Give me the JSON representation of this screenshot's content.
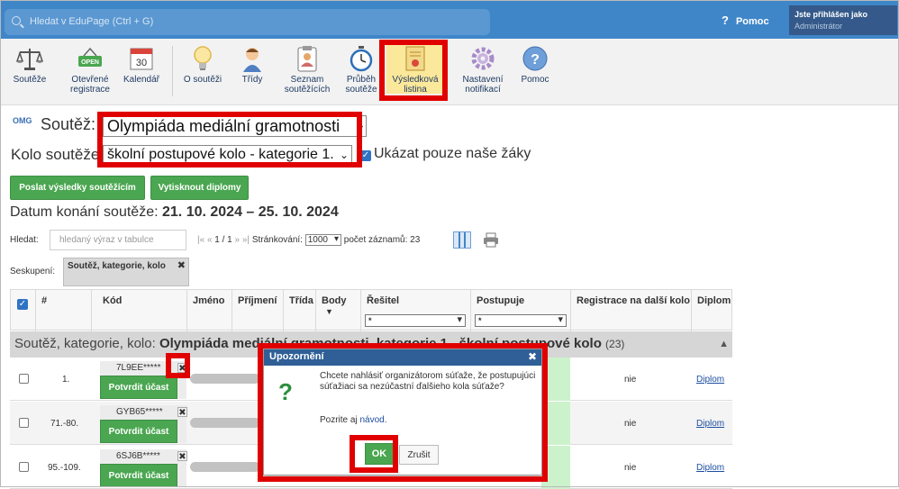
{
  "topbar": {
    "search_placeholder": "Hledat v EduPage (Ctrl + G)",
    "help_label": "Pomoc",
    "user_line": "Jste přihlášen jako",
    "user_role": "Administrátor"
  },
  "toolbar": {
    "items": [
      {
        "label": "Soutěže"
      },
      {
        "label": "Otevřené registrace",
        "badge": "OPEN"
      },
      {
        "label": "Kalendář",
        "badge": "30"
      },
      {
        "label": "O soutěži"
      },
      {
        "label": "Třídy"
      },
      {
        "label": "Seznam soutěžících"
      },
      {
        "label": "Průběh soutěže"
      },
      {
        "label": "Výsledková listina"
      },
      {
        "label": "Nastavení notifikací"
      },
      {
        "label": "Pomoc"
      }
    ]
  },
  "competition": {
    "logo_text": "OMG",
    "label": "Soutěž:",
    "selected": "Olympiáda mediální gramotnosti",
    "round_label": "Kolo soutěže:",
    "round_selected": "školní postupové kolo - kategorie 1.",
    "only_ours_label": "Ukázat pouze naše žáky",
    "send_results_label": "Poslat výsledky soutěžícím",
    "print_diplomas_label": "Vytisknout diplomy",
    "date_label": "Datum konání soutěže:",
    "date_value": "21. 10. 2024 – 25. 10. 2024"
  },
  "filter": {
    "search_label": "Hledat:",
    "search_placeholder": "hledaný výraz v tabulce",
    "pager_prefix": "|« «",
    "pager_pages": "1 / 1",
    "pager_suffix": "» »|",
    "paging_label": "Stránkování:",
    "paging_value": "1000",
    "count_text": "počet záznamů: 23",
    "grouping_label": "Seskupení:",
    "grouping_tag": "Soutěž, kategorie, kolo",
    "grouping_remove": "✖"
  },
  "table": {
    "headers": [
      "#",
      "Kód",
      "Jméno",
      "Příjmení",
      "Třída",
      "Body",
      "Řešitel",
      "Postupuje",
      "Registrace na další kolo",
      "Diplom"
    ],
    "sort_arrow": "▼",
    "filter_value": "*",
    "group_prefix": "Soutěž, kategorie, kolo:",
    "group_name": "Olympiáda mediální gramotnosti, kategorie 1., školní postupové kolo",
    "group_count": "(23)",
    "rows": [
      {
        "num": "1.",
        "code": "7L9EE*****",
        "confirm": "Potvrdit účast",
        "registration": "nie",
        "diploma": "Diplom"
      },
      {
        "num": "71.-80.",
        "code": "GYB65*****",
        "confirm": "Potvrdit účast",
        "registration": "nie",
        "diploma": "Diplom"
      },
      {
        "num": "95.-109.",
        "code": "6SJ6B*****",
        "confirm": "Potvrdit účast",
        "registration": "nie",
        "diploma": "Diplom"
      }
    ],
    "remove_glyph": "✖"
  },
  "dialog": {
    "title": "Upozornění",
    "close_glyph": "✖",
    "icon_glyph": "?",
    "message": "Chcete nahlásiť organizátorom súťaže, že postupujúci súťažiaci sa nezúčastní ďalšieho kola súťaže?",
    "hint_prefix": "Pozrite aj",
    "hint_link": "návod.",
    "ok_label": "OK",
    "cancel_label": "Zrušit"
  },
  "colors": {
    "topbar": "#3f86c9",
    "button_green": "#4aa650",
    "dialog_header": "#2f5f96",
    "highlight": "#e00000"
  }
}
